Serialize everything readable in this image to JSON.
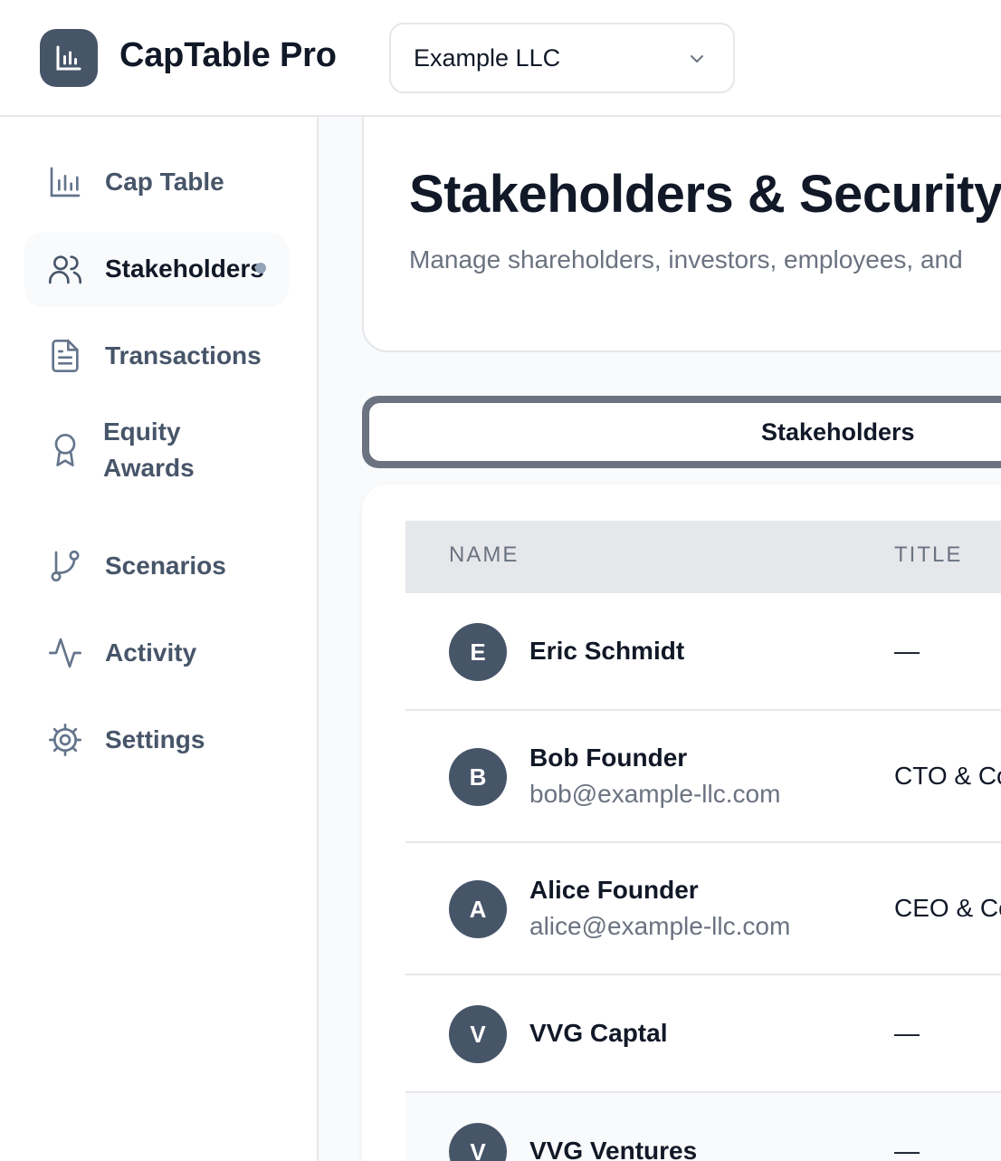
{
  "app": {
    "title": "CapTable Pro",
    "logo_icon": "bar-chart-icon",
    "company_selector": {
      "value": "Example LLC",
      "icon": "chevron-down-icon"
    }
  },
  "sidebar": {
    "items": [
      {
        "label": "Cap Table",
        "icon": "bar-chart-icon",
        "active": false
      },
      {
        "label": "Stakeholders",
        "icon": "users-icon",
        "active": true
      },
      {
        "label": "Transactions",
        "icon": "file-text-icon",
        "active": false
      },
      {
        "label": "Equity Awards",
        "icon": "award-icon",
        "active": false
      },
      {
        "label": "Scenarios",
        "icon": "git-branch-icon",
        "active": false
      },
      {
        "label": "Activity",
        "icon": "activity-icon",
        "active": false
      },
      {
        "label": "Settings",
        "icon": "gear-icon",
        "active": false
      }
    ]
  },
  "main": {
    "heading": "Stakeholders & Security",
    "subheading": "Manage shareholders, investors, employees, and",
    "tabs": [
      {
        "label": "Stakeholders",
        "active": true
      }
    ],
    "table": {
      "columns": [
        "NAME",
        "TITLE"
      ],
      "rows": [
        {
          "initial": "E",
          "name": "Eric Schmidt",
          "email": "",
          "title": "—"
        },
        {
          "initial": "B",
          "name": "Bob Founder",
          "email": "bob@example-llc.com",
          "title": "CTO & Co"
        },
        {
          "initial": "A",
          "name": "Alice Founder",
          "email": "alice@example-llc.com",
          "title": "CEO & Co"
        },
        {
          "initial": "V",
          "name": "VVG Captal",
          "email": "",
          "title": "—"
        },
        {
          "initial": "V",
          "name": "VVG Ventures",
          "email": "",
          "title": "—"
        }
      ]
    }
  },
  "colors": {
    "accent": "#475569",
    "border": "#e5e7eb",
    "muted_text": "#6b7280",
    "tab_track": "#6b7280"
  }
}
